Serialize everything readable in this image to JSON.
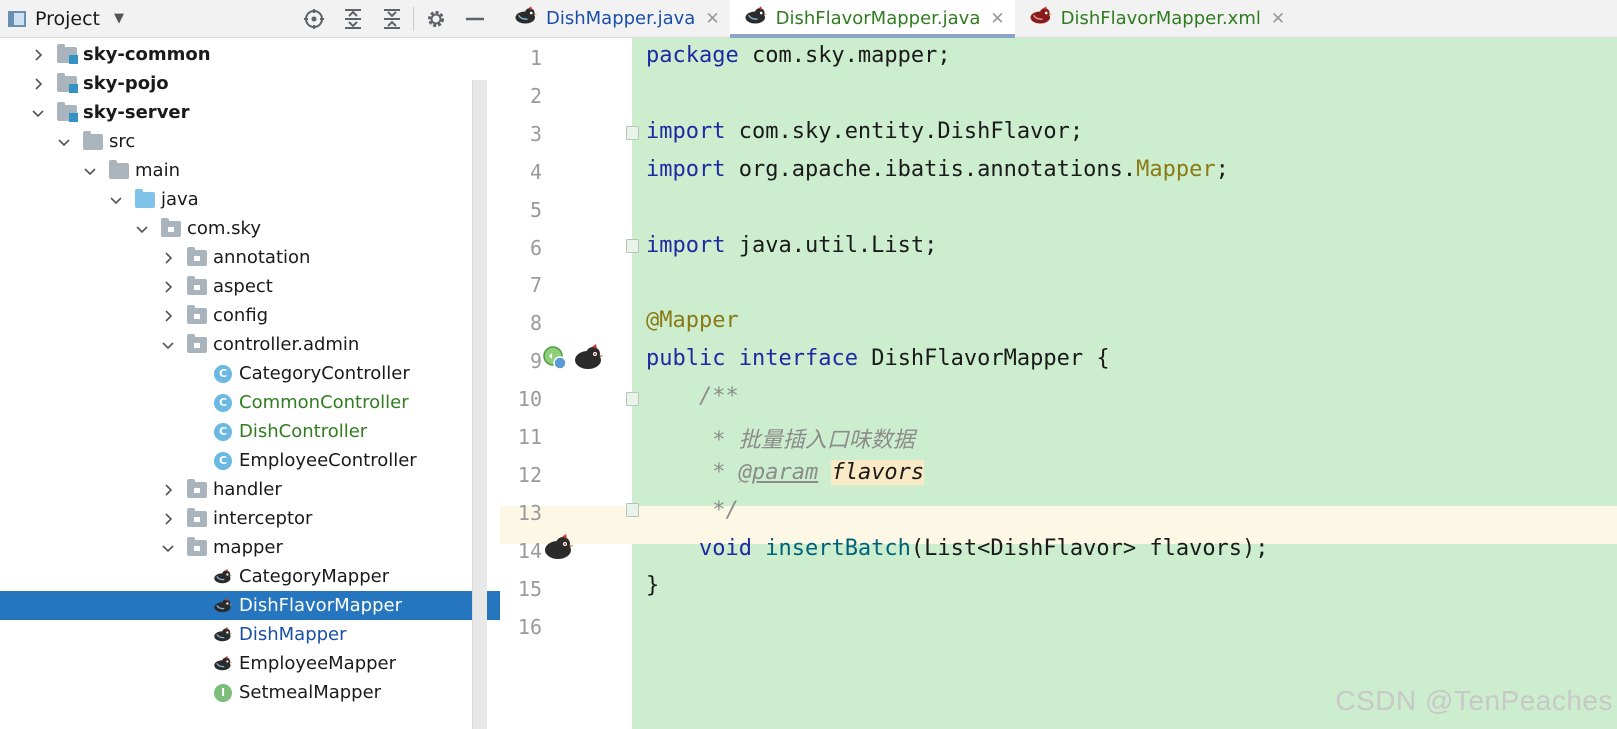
{
  "project_panel": {
    "title": "Project",
    "tools": [
      "crosshair-icon",
      "expand-all-icon",
      "collapse-all-icon",
      "gear-icon",
      "minimize-icon"
    ],
    "tree": [
      {
        "label": "sky-common",
        "depth": 0,
        "state": "collapsed",
        "icon": "module-folder-icon",
        "bold": true
      },
      {
        "label": "sky-pojo",
        "depth": 0,
        "state": "collapsed",
        "icon": "module-folder-icon",
        "bold": true
      },
      {
        "label": "sky-server",
        "depth": 0,
        "state": "expanded",
        "icon": "module-folder-icon",
        "bold": true
      },
      {
        "label": "src",
        "depth": 1,
        "state": "expanded",
        "icon": "folder-icon"
      },
      {
        "label": "main",
        "depth": 2,
        "state": "expanded",
        "icon": "folder-icon"
      },
      {
        "label": "java",
        "depth": 3,
        "state": "expanded",
        "icon": "source-folder-icon"
      },
      {
        "label": "com.sky",
        "depth": 4,
        "state": "expanded",
        "icon": "package-icon"
      },
      {
        "label": "annotation",
        "depth": 5,
        "state": "collapsed",
        "icon": "package-icon"
      },
      {
        "label": "aspect",
        "depth": 5,
        "state": "collapsed",
        "icon": "package-icon"
      },
      {
        "label": "config",
        "depth": 5,
        "state": "collapsed",
        "icon": "package-icon"
      },
      {
        "label": "controller.admin",
        "depth": 5,
        "state": "expanded",
        "icon": "package-icon"
      },
      {
        "label": "CategoryController",
        "depth": 6,
        "state": "leaf",
        "icon": "class-icon"
      },
      {
        "label": "CommonController",
        "depth": 6,
        "state": "leaf",
        "icon": "class-icon",
        "color": "green"
      },
      {
        "label": "DishController",
        "depth": 6,
        "state": "leaf",
        "icon": "class-icon",
        "color": "green"
      },
      {
        "label": "EmployeeController",
        "depth": 6,
        "state": "leaf",
        "icon": "class-icon"
      },
      {
        "label": "handler",
        "depth": 5,
        "state": "collapsed",
        "icon": "package-icon"
      },
      {
        "label": "interceptor",
        "depth": 5,
        "state": "collapsed",
        "icon": "package-icon"
      },
      {
        "label": "mapper",
        "depth": 5,
        "state": "expanded",
        "icon": "package-icon"
      },
      {
        "label": "CategoryMapper",
        "depth": 6,
        "state": "leaf",
        "icon": "mybatis-bird-icon"
      },
      {
        "label": "DishFlavorMapper",
        "depth": 6,
        "state": "leaf",
        "icon": "mybatis-bird-icon",
        "selected": true
      },
      {
        "label": "DishMapper",
        "depth": 6,
        "state": "leaf",
        "icon": "mybatis-bird-icon",
        "color": "blue"
      },
      {
        "label": "EmployeeMapper",
        "depth": 6,
        "state": "leaf",
        "icon": "mybatis-bird-icon"
      },
      {
        "label": "SetmealMapper",
        "depth": 6,
        "state": "leaf",
        "icon": "interface-icon"
      }
    ]
  },
  "tabs": [
    {
      "label": "DishMapper.java",
      "icon": "mybatis-bird-icon",
      "active": false
    },
    {
      "label": "DishFlavorMapper.java",
      "icon": "mybatis-bird-icon",
      "active": true
    },
    {
      "label": "DishFlavorMapper.xml",
      "icon": "mybatis-red-bird-icon",
      "active": false
    }
  ],
  "editor": {
    "line_numbers": [
      "1",
      "2",
      "3",
      "4",
      "5",
      "6",
      "7",
      "8",
      "9",
      "10",
      "11",
      "12",
      "13",
      "14",
      "15",
      "16"
    ],
    "code": {
      "l1_kw": "package",
      "l1_rest": " com.sky.mapper;",
      "l3_kw": "import",
      "l3_rest": " com.sky.entity.DishFlavor;",
      "l4_kw": "import",
      "l4_rest": " org.apache.ibatis.annotations.",
      "l4_ann": "Mapper",
      "l4_end": ";",
      "l6_kw": "import",
      "l6_rest": " java.util.List;",
      "l8_ann": "@Mapper",
      "l9_kw1": "public",
      "l9_kw2": "interface",
      "l9_rest": " DishFlavorMapper {",
      "l10": "    /**",
      "l11": "     * 批量插入口味数据",
      "l12_star": "     * ",
      "l12_tag": "@param",
      "l12_sp": " ",
      "l12_hl": "flavors",
      "l13": "     */",
      "l14_kw": "    void",
      "l14_meth": "insertBatch",
      "l14_rest": "(List<DishFlavor> flavors);",
      "l15": "}"
    },
    "caret_line": 13
  },
  "watermark": "CSDN @TenPeaches"
}
